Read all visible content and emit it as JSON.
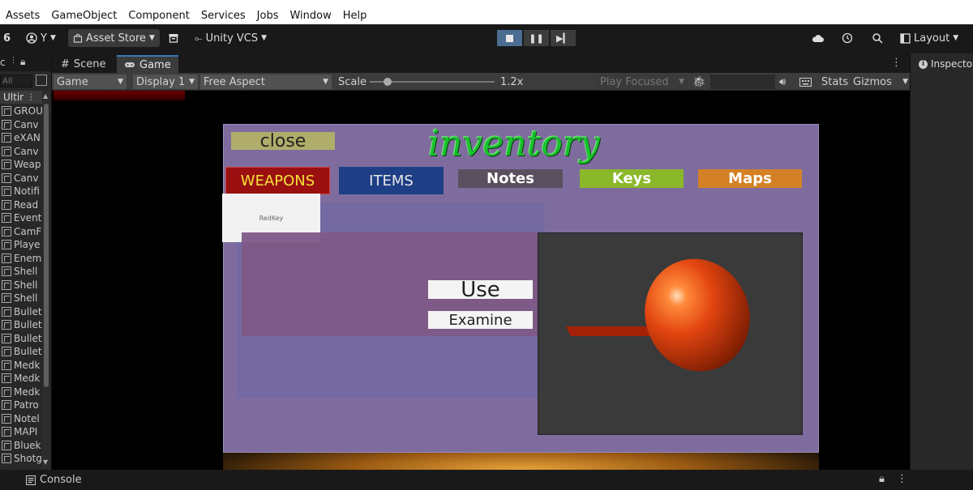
{
  "menubar": {
    "items": [
      "Assets",
      "GameObject",
      "Component",
      "Services",
      "Jobs",
      "Window",
      "Help"
    ]
  },
  "toolbar": {
    "version_badge": "6",
    "account_label": "Y",
    "asset_store_label": "Asset Store",
    "vcs_label": "Unity VCS",
    "layout_label": "Layout"
  },
  "hierarchy": {
    "search_placeholder": "All",
    "root_label": "Ultir",
    "items": [
      "GROU",
      "Canv",
      "eXAN",
      "Canv",
      "Weap",
      "Canv",
      "Notifi",
      "Read",
      "Event",
      "CamF",
      "Playe",
      "Enem",
      "Shell",
      "Shell",
      "Shell",
      "Bullet",
      "Bullet",
      "Bullet",
      "Bullet",
      "Medk",
      "Medk",
      "Medk",
      "Patro",
      "Notel",
      "MAPI",
      "Bluek",
      "Shotg"
    ]
  },
  "tabs": {
    "scene": "Scene",
    "game": "Game"
  },
  "gamebar": {
    "view_mode": "Game",
    "display": "Display 1",
    "aspect": "Free Aspect",
    "scale_label": "Scale",
    "scale_value": "1.2x",
    "scale_fraction": 0.12,
    "play_mode": "Play Focused",
    "stats_label": "Stats",
    "gizmos_label": "Gizmos"
  },
  "inspector": {
    "tab_label": "Inspecto"
  },
  "statusbar": {
    "console_label": "Console"
  },
  "inventory": {
    "title": "inventory",
    "close_label": "close",
    "tabs": {
      "weapons": "WEAPONS",
      "items": "ITEMS",
      "notes": "Notes",
      "keys": "Keys",
      "maps": "Maps"
    },
    "slot_item": "RedKey",
    "use_label": "Use",
    "examine_label": "Examine"
  },
  "colors": {
    "panel": "#7f6c9e",
    "title_green": "#19c22e",
    "weapons_bg": "#9a1010",
    "items_bg": "#1e3f86",
    "keys_bg": "#8ab82a",
    "maps_bg": "#d48126",
    "accent_tab": "#3a79bb",
    "play_active": "#4b6d91"
  }
}
